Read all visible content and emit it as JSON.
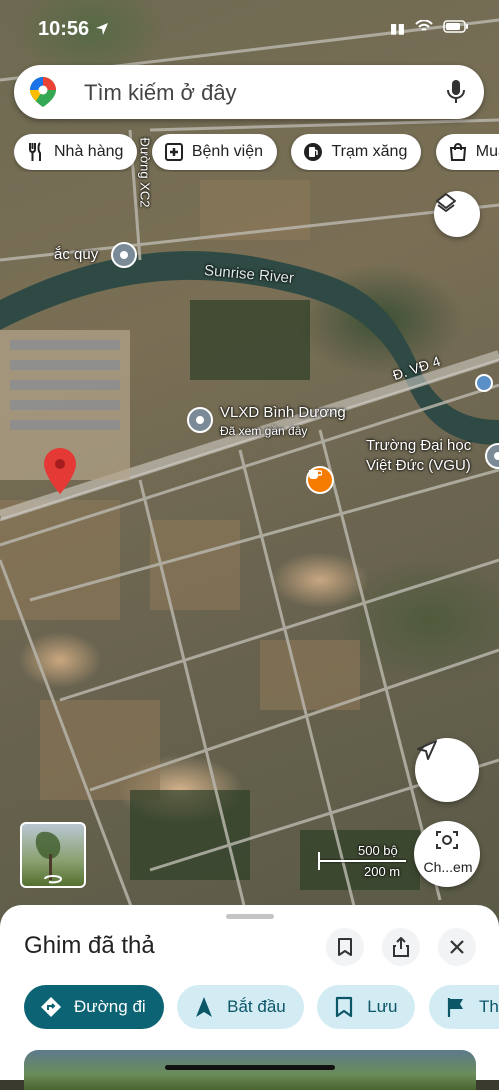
{
  "status_bar": {
    "time": "10:56",
    "signal": "▮▮"
  },
  "search": {
    "placeholder": "Tìm kiếm ở đây"
  },
  "chips": [
    {
      "label": "Nhà hàng",
      "icon": "restaurant-icon"
    },
    {
      "label": "Bệnh viện",
      "icon": "hospital-icon"
    },
    {
      "label": "Trạm xăng",
      "icon": "gas-station-icon"
    },
    {
      "label": "Mua s",
      "icon": "shopping-bag-icon"
    }
  ],
  "map": {
    "labels": {
      "street_xc2": "Đường XC2",
      "battery_place": "ắc quy",
      "river": "Sunrise River",
      "road_vd4": "Đ. VĐ 4",
      "place_name": "VLXD Bình Dương",
      "place_sub": "Đã xem gần đây",
      "university_line1": "Trường Đại học",
      "university_line2": "Việt Đức (VGU)"
    },
    "scale": {
      "metric_top": "500 bộ",
      "metric_bottom": "200 m"
    },
    "streetview_label": "Ch...em"
  },
  "sheet": {
    "title": "Ghim đã thả",
    "actions": [
      {
        "label": "Đường đi",
        "icon": "directions-icon",
        "primary": true
      },
      {
        "label": "Bắt đầu",
        "icon": "navigation-arrow-icon",
        "primary": false
      },
      {
        "label": "Lưu",
        "icon": "bookmark-icon",
        "primary": false
      },
      {
        "label": "Thêm",
        "icon": "flag-icon",
        "primary": false
      }
    ]
  },
  "colors": {
    "accent": "#0b6374",
    "chip_light": "#d3ecf4",
    "pin_red": "#e53935",
    "cafe_orange": "#f57c00"
  }
}
